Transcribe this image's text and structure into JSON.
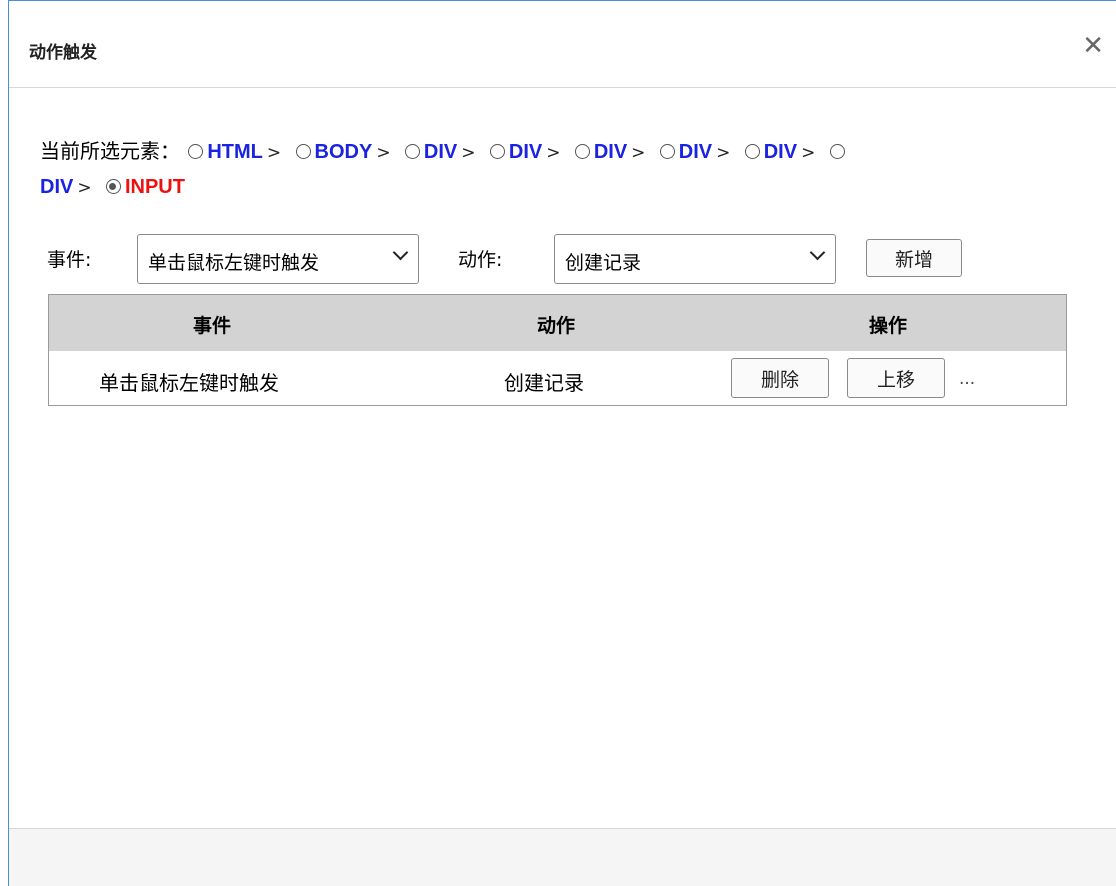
{
  "dialog": {
    "title": "动作触发",
    "close_glyph": "✕"
  },
  "selected_path": {
    "label": "当前所选元素：",
    "separator": ">",
    "elements": [
      "HTML",
      "BODY",
      "DIV",
      "DIV",
      "DIV",
      "DIV",
      "DIV",
      "DIV",
      "INPUT"
    ],
    "selected_index": 8
  },
  "form": {
    "event_label": "事件:",
    "event_value": "单击鼠标左键时触发",
    "action_label": "动作:",
    "action_value": "创建记录",
    "add_button": "新增"
  },
  "table": {
    "headers": [
      "事件",
      "动作",
      "操作"
    ],
    "rows": [
      {
        "event": "单击鼠标左键时触发",
        "action": "创建记录",
        "delete": "删除",
        "move_up": "上移",
        "more": "..."
      }
    ]
  },
  "colors": {
    "tag": "#1a23e0",
    "selected_tag": "#ee1111",
    "header_bg": "#d3d3d3"
  }
}
